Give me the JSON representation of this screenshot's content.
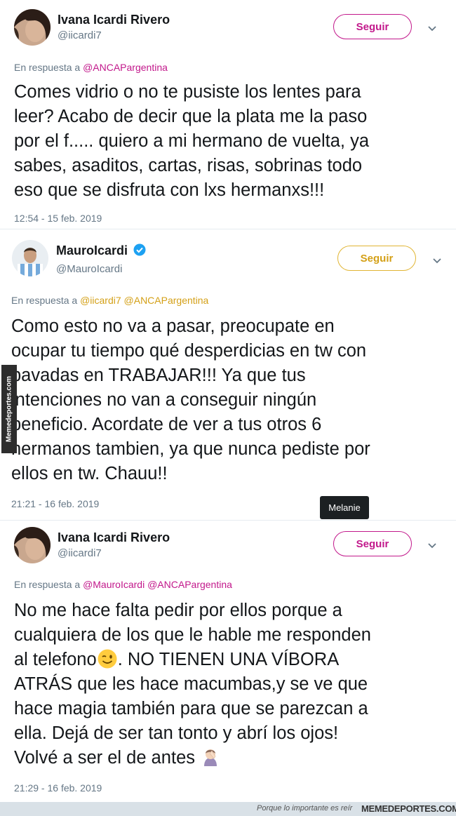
{
  "tweets": [
    {
      "name": "Ivana Icardi Rivero",
      "handle": "@iicardi7",
      "follow_label": "Seguir",
      "reply_prefix": "En respuesta a",
      "reply_mentions": "@ANCAPargentina",
      "lines": [
        "Comes vidrio o no te pusiste los lentes para",
        "leer? Acabo de decir que la plata me la paso",
        "por el f..... quiero a mi hermano de vuelta, ya",
        "sabes, asaditos, cartas, risas, sobrinas todo",
        "eso que se disfruta con lxs hermanxs!!!"
      ],
      "timestamp": "12:54 - 15 feb. 2019"
    },
    {
      "name": "MauroIcardi",
      "verified": true,
      "handle": "@MauroIcardi",
      "follow_label": "Seguir",
      "reply_prefix": "En respuesta a",
      "reply_mentions": "@iicardi7 @ANCAPargentina",
      "lines": [
        "Como esto no va a pasar, preocupate en",
        "ocupar tu tiempo qué desperdicias en tw con",
        "pavadas en TRABAJAR!!! Ya que tus",
        "intenciones no van a conseguir ningún",
        "beneficio. Acordate de ver a tus otros 6",
        "hermanos tambien, ya que nunca pediste por",
        "ellos en tw. Chauu!!"
      ],
      "timestamp": "21:21 - 16 feb. 2019"
    },
    {
      "name": "Ivana Icardi Rivero",
      "handle": "@iicardi7",
      "follow_label": "Seguir",
      "reply_prefix": "En respuesta a",
      "reply_mentions": "@MauroIcardi @ANCAPargentina",
      "lines": [
        "No me hace falta pedir por ellos porque a",
        "cualquiera de los que le hable me responden",
        "al telefono",
        ". NO TIENEN UNA VÍBORA",
        "ATRÁS que les hace macumbas,y se ve que",
        "hace magia también para que se parezcan a",
        "ella. Dejá de ser tan tonto y abrí los ojos!",
        "Volvé a ser el de antes"
      ],
      "timestamp": "21:29 - 16 feb. 2019"
    }
  ],
  "tooltip": "Melanie",
  "watermark_side": "Memedeportes.com",
  "footer": {
    "slogan": "Porque lo importante es reír",
    "brand": "MEMEDEPORTES.COM"
  },
  "colors": {
    "follow_pink": "#c2188b",
    "follow_gold": "#e1b533",
    "verified": "#1da1f2",
    "meta_gray": "#657786"
  },
  "icons": [
    "chevron-down-icon",
    "verified-badge-icon",
    "wink-emoji",
    "facepalm-emoji"
  ]
}
